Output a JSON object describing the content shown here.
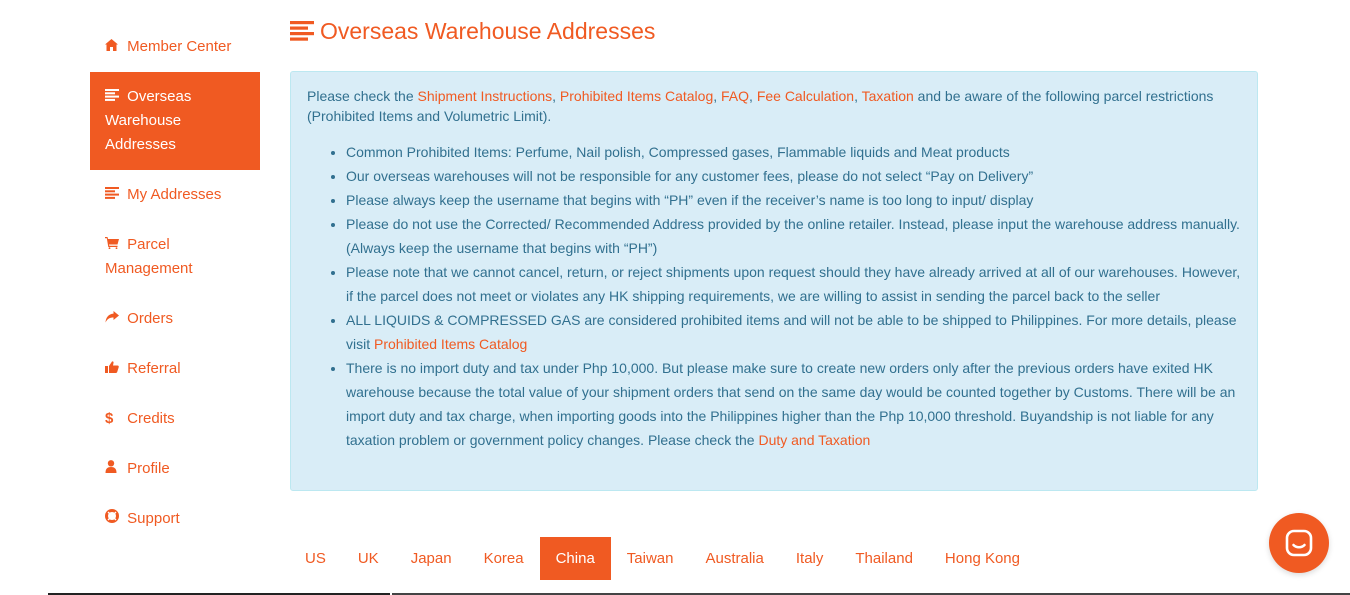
{
  "sidebar": {
    "items": [
      {
        "label": "Member Center",
        "icon": "home-icon"
      },
      {
        "label": "Overseas Warehouse Addresses",
        "icon": "list-icon",
        "active": true
      },
      {
        "label": "My Addresses",
        "icon": "list-icon"
      },
      {
        "label": "Parcel Management",
        "icon": "cart-icon"
      },
      {
        "label": "Orders",
        "icon": "share-icon"
      },
      {
        "label": "Referral",
        "icon": "thumbs-up-icon"
      },
      {
        "label": "Credits",
        "icon": "dollar-icon"
      },
      {
        "label": "Profile",
        "icon": "user-icon"
      },
      {
        "label": "Support",
        "icon": "lifebuoy-icon"
      }
    ]
  },
  "page": {
    "title": "Overseas Warehouse Addresses"
  },
  "notice": {
    "intro_prefix": "Please check the ",
    "links": {
      "shipment": "Shipment Instructions",
      "prohibited": "Prohibited Items Catalog",
      "faq": "FAQ",
      "fee": "Fee Calculation",
      "taxation": "Taxation"
    },
    "sep": ", ",
    "intro_suffix": " and be aware of the following parcel restrictions (Prohibited Items and Volumetric Limit).",
    "bullets": {
      "b1": "Common Prohibited Items: Perfume, Nail polish, Compressed gases, Flammable liquids and Meat products",
      "b2": "Our overseas warehouses will not be responsible for any customer fees, please do not select “Pay on Delivery”",
      "b3": "Please always keep the username that begins with “PH” even if the receiver’s name is too long to input/ display",
      "b4": "Please do not use the Corrected/ Recommended Address provided by the online retailer. Instead, please input the warehouse address manually. (Always keep the username that begins with “PH”)",
      "b5": "Please note that we cannot cancel, return, or reject shipments upon request should they have already arrived at all of our warehouses. However, if the parcel does not meet or violates any HK shipping requirements, we are willing to assist in sending the parcel back to the seller",
      "b6_text": "ALL LIQUIDS & COMPRESSED GAS are considered prohibited items and will not be able to be shipped to Philippines. For more details, please visit ",
      "b6_link": "Prohibited Items Catalog",
      "b7_text": "There is no import duty and tax under Php 10,000. But please make sure to create new orders only after the previous orders have exited HK warehouse because the total value of your shipment orders that send on the same day would be counted together by Customs. There will be an import duty and tax charge, when importing goods into the Philippines higher than the Php 10,000 threshold. Buyandship is not liable for any taxation problem or government policy changes. Please check the ",
      "b7_link": "Duty and Taxation"
    }
  },
  "tabs": [
    {
      "label": "US"
    },
    {
      "label": "UK"
    },
    {
      "label": "Japan"
    },
    {
      "label": "Korea"
    },
    {
      "label": "China",
      "active": true
    },
    {
      "label": "Taiwan"
    },
    {
      "label": "Australia"
    },
    {
      "label": "Italy"
    },
    {
      "label": "Thailand"
    },
    {
      "label": "Hong Kong"
    }
  ],
  "chat": {
    "icon": "chat-icon"
  },
  "colors": {
    "accent": "#f05a22",
    "info_bg": "#d9edf7",
    "info_text": "#31708f"
  }
}
